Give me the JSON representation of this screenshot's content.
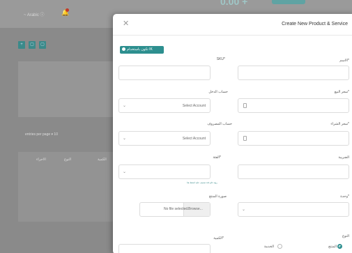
{
  "background": {
    "language": "~ Arabic ⓘ",
    "price": "0.00 +",
    "square_labels": [
      "+",
      "▢",
      "▢"
    ],
    "per_page": "entries per page  ▾  10",
    "table_headers": [
      "الكمية",
      "النوع",
      "الاجراء"
    ]
  },
  "modal": {
    "title": "Create New Product & Service",
    "toggle_label": "تكون باستخدام IK",
    "fields": {
      "name_label": "الاسم*",
      "sku_label": "SKU*",
      "sale_price_label": "سعر البيع*",
      "income_account_label": "حساب الدخل",
      "income_account_value": "Select Account",
      "purchase_price_label": "سعر الشراء*",
      "expense_account_label": "حساب المصروف",
      "expense_account_value": "Select Account",
      "tax_label": "الضريبة",
      "category_label": "الفئة*",
      "category_helper": "رؤية علم فئة تصنيف عليه اضغط هنا",
      "unit_label": "وحدة*",
      "image_label": "صورة المنتج",
      "file_browse": "Browse...",
      "file_status": "No file selected.",
      "type_label": "النوع",
      "quantity_label": "الكمية*",
      "radio_product": "المنتج",
      "radio_service": "الخدمة"
    }
  }
}
